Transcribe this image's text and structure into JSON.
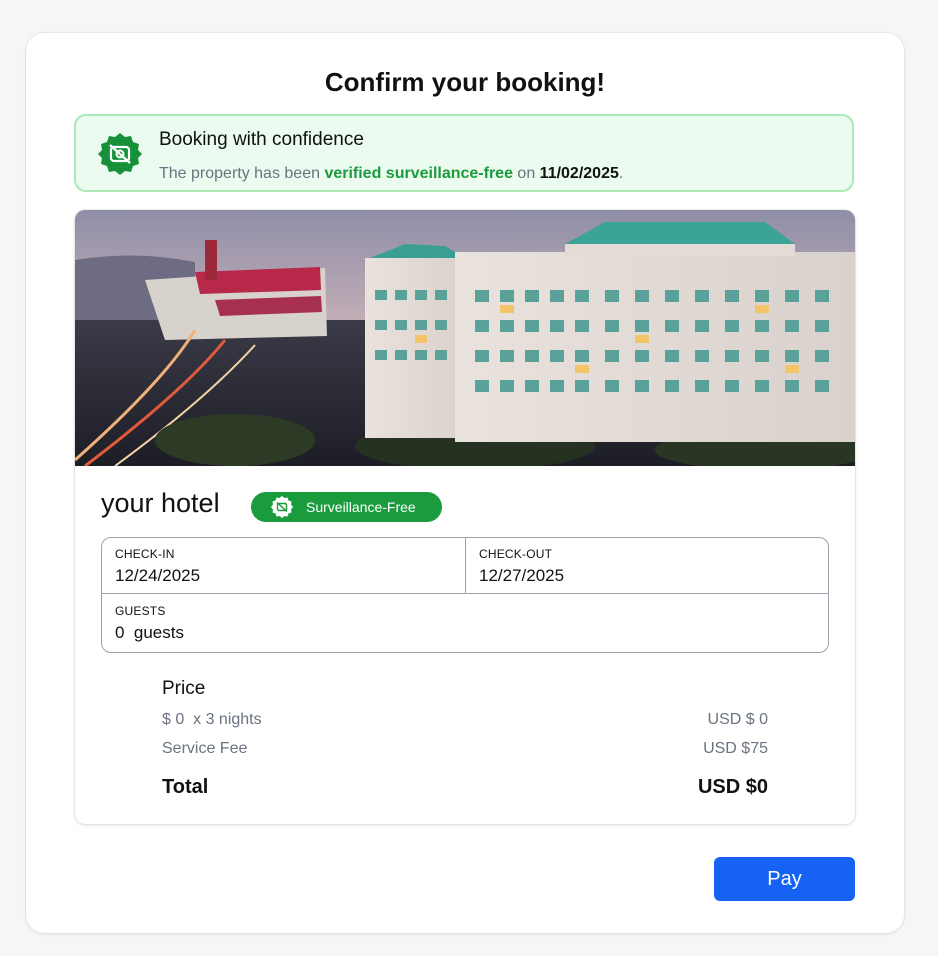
{
  "dialog": {
    "title": "Confirm your booking!"
  },
  "banner": {
    "icon": "shield-no-camera-icon",
    "title": "Booking with confidence",
    "text_prefix": "The property has been ",
    "text_highlight": "verified surveillance-free",
    "text_middle": " on ",
    "date": "11/02/2025",
    "text_suffix": "."
  },
  "hotel": {
    "photo_alt": "Hotel building with stadium at dusk",
    "name": "your hotel",
    "badge_label": "Surveillance-Free"
  },
  "details": {
    "checkin_label": "CHECK-IN",
    "checkin_value": "12/24/2025",
    "checkout_label": "CHECK-OUT",
    "checkout_value": "12/27/2025",
    "guests_label": "GUESTS",
    "guests_value": "0  guests"
  },
  "price": {
    "title": "Price",
    "rows": [
      {
        "label": "$ 0  x 3 nights",
        "value": "USD $ 0"
      },
      {
        "label": "Service Fee",
        "value": "USD $75"
      }
    ],
    "total_label": "Total",
    "total_value": "USD $0"
  },
  "actions": {
    "pay_label": "Pay"
  },
  "colors": {
    "accent_green": "#1a9c3e",
    "banner_bg": "#ecfbef",
    "pay_blue": "#1662f5"
  }
}
